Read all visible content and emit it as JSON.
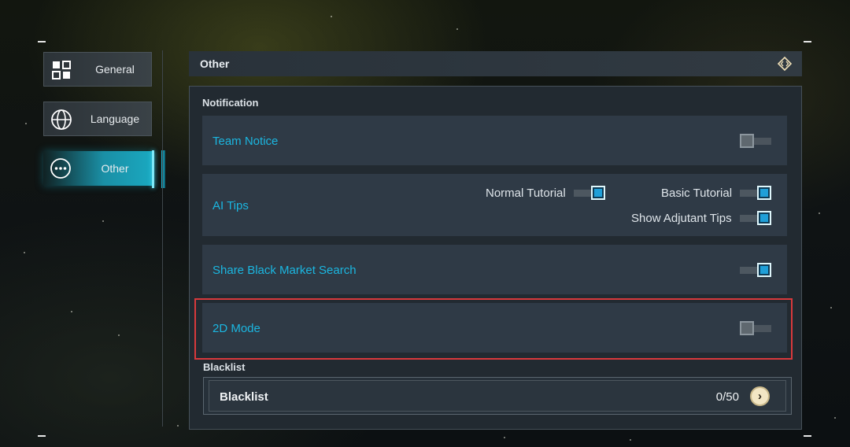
{
  "sidebar": {
    "items": [
      {
        "label": "General",
        "icon": "grid-icon",
        "active": false
      },
      {
        "label": "Language",
        "icon": "globe-icon",
        "active": false
      },
      {
        "label": "Other",
        "icon": "more-dots-icon",
        "active": true
      }
    ]
  },
  "header": {
    "title": "Other",
    "icon": "diamond-code-icon"
  },
  "notification": {
    "section_label": "Notification",
    "team_notice": {
      "label": "Team Notice",
      "enabled": false
    },
    "ai_tips": {
      "label": "AI Tips",
      "normal_tutorial": {
        "label": "Normal Tutorial",
        "enabled": true
      },
      "basic_tutorial": {
        "label": "Basic Tutorial",
        "enabled": true
      },
      "show_adjutant_tips": {
        "label": "Show Adjutant Tips",
        "enabled": true
      }
    },
    "share_black_market": {
      "label": "Share Black Market Search",
      "enabled": true
    },
    "mode_2d": {
      "label": "2D Mode",
      "enabled": false
    }
  },
  "blacklist": {
    "section_label": "Blacklist",
    "name": "Blacklist",
    "count": "0/50",
    "arrow_icon": "chevron-right-icon"
  },
  "colors": {
    "accent": "#1bb6e0",
    "highlight_border": "#d8393c",
    "toggle_on": "#1f9fd8"
  }
}
